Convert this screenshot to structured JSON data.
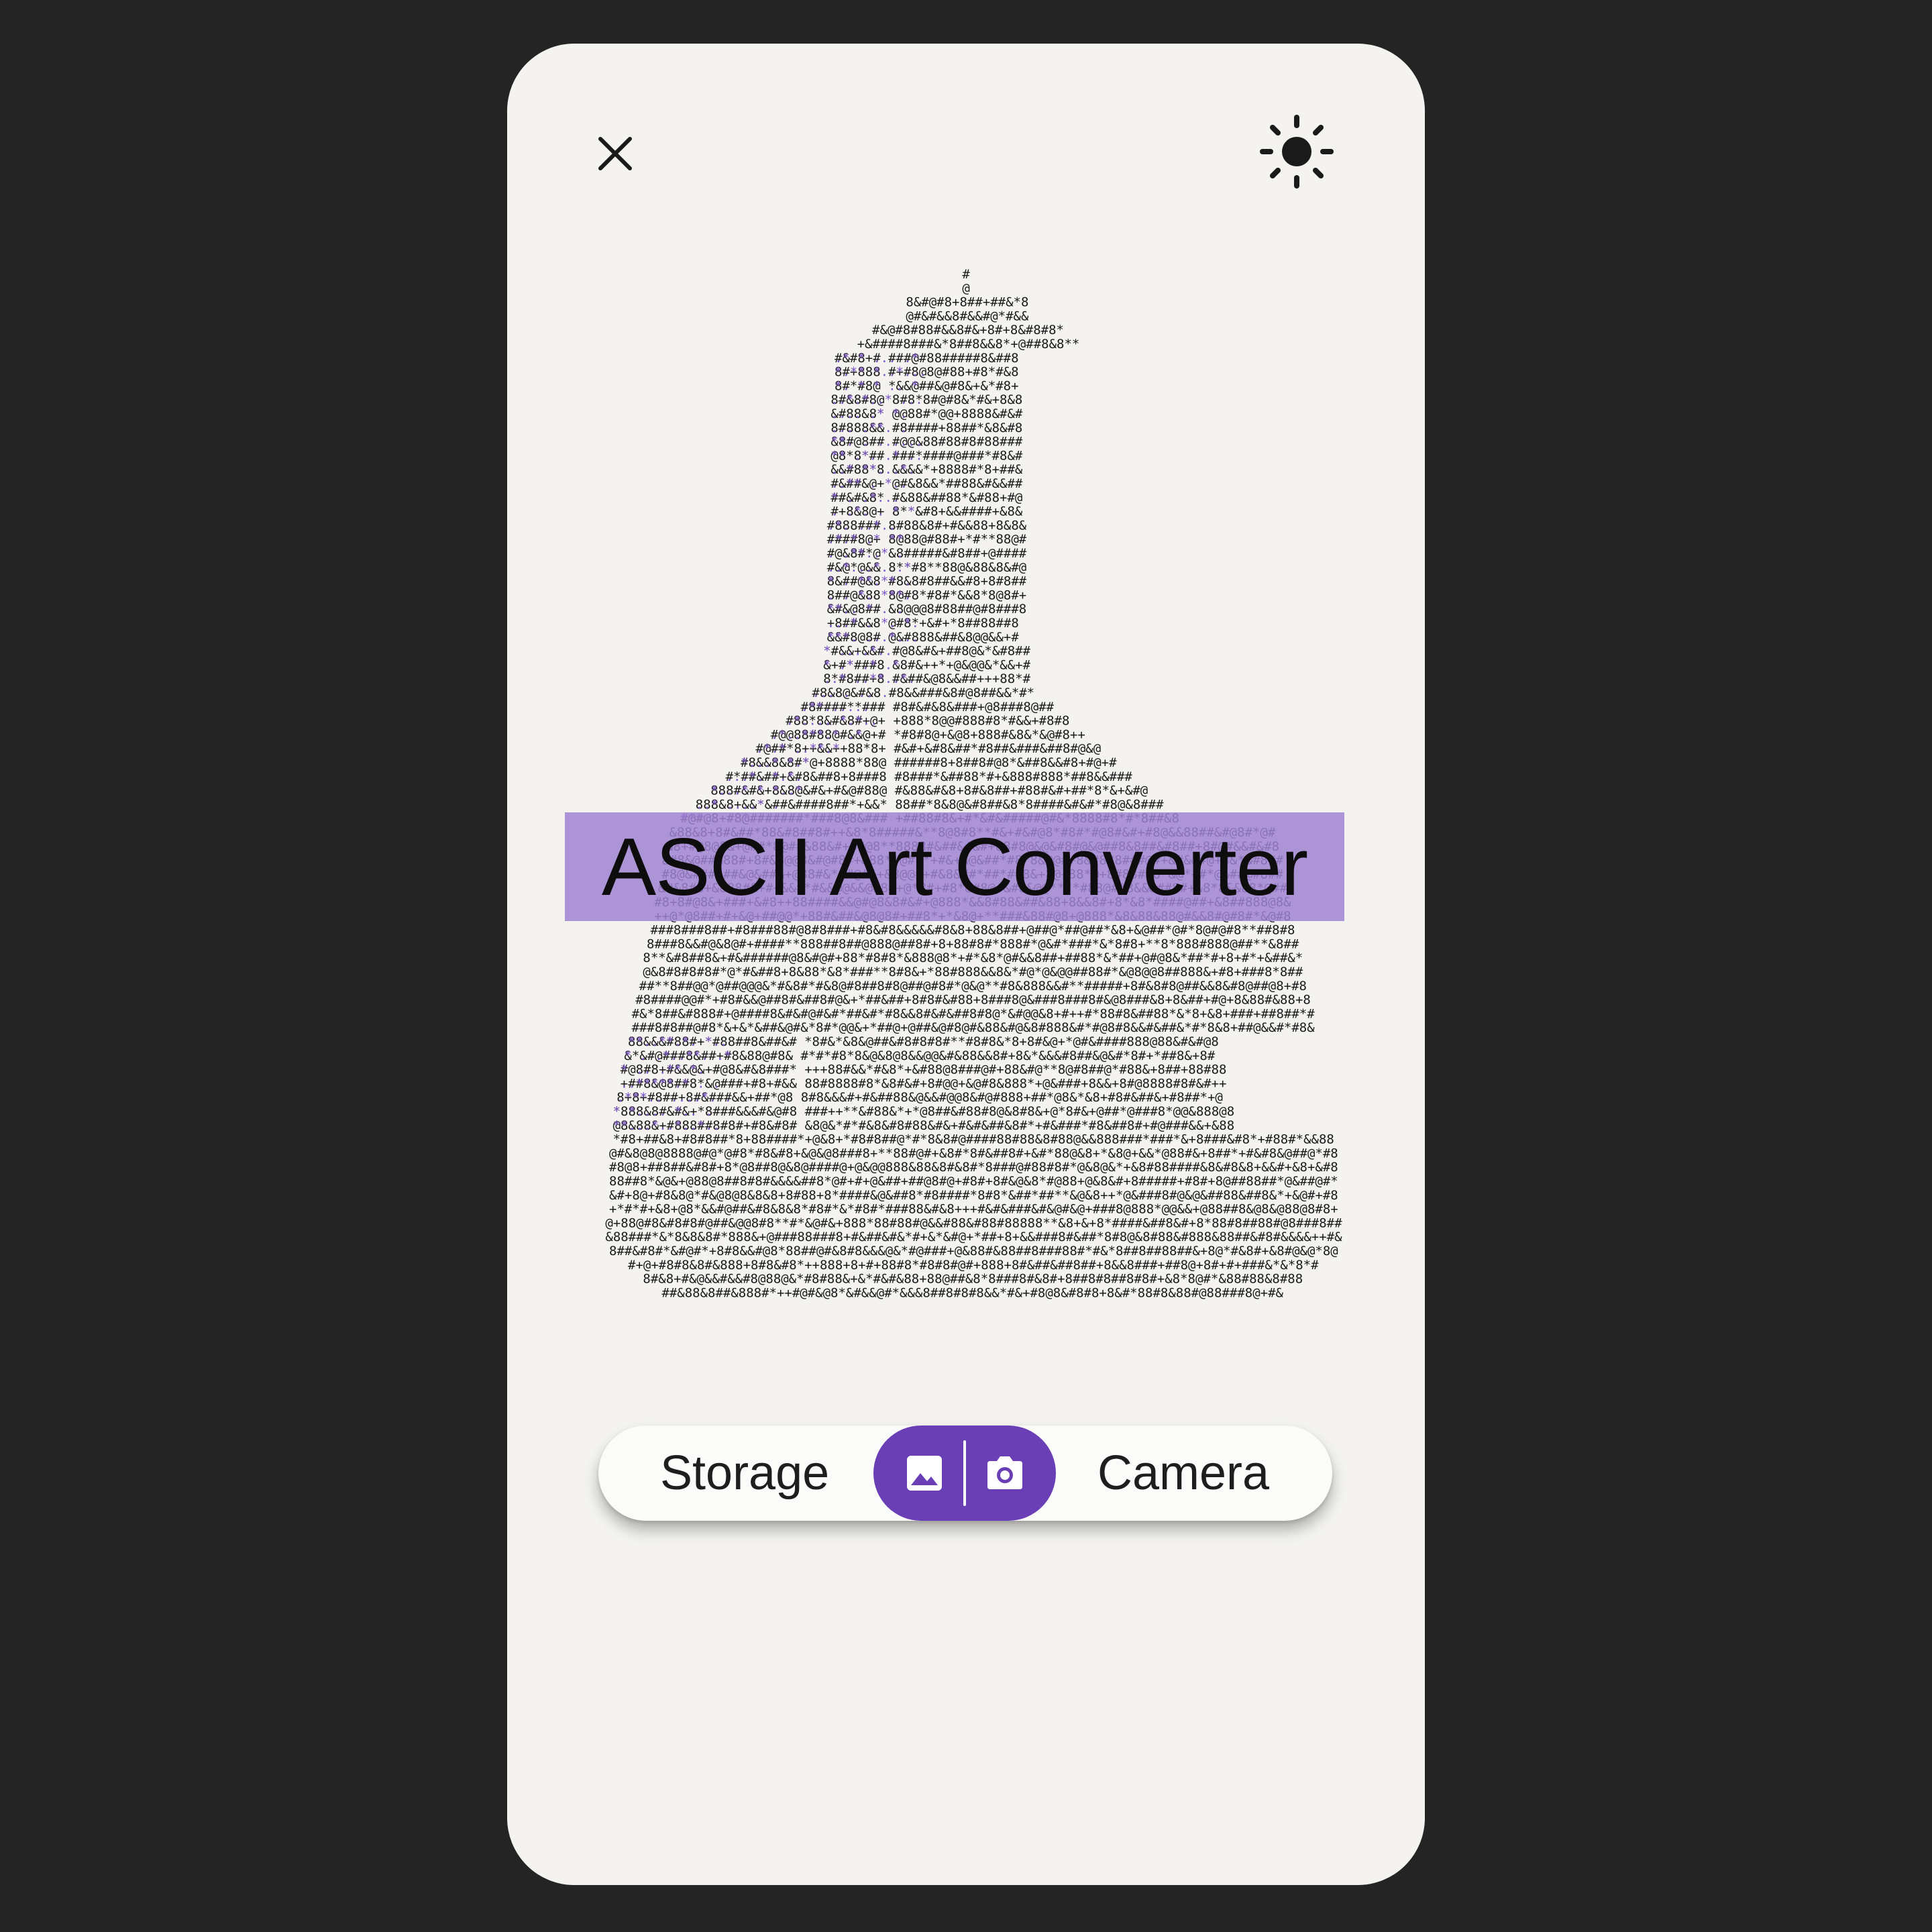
{
  "app": {
    "title": "ASCII Art Converter"
  },
  "toolbar": {
    "close_icon": "close-icon",
    "theme_icon": "sun-icon"
  },
  "source_selector": {
    "storage_label": "Storage",
    "camera_label": "Camera",
    "storage_icon": "image-icon",
    "camera_icon": "camera-icon"
  },
  "colors": {
    "accent": "#6a3fb5",
    "title_band": "#a082d2",
    "background": "#242424",
    "card": "#f4f3f0",
    "ascii_ink": "#1a1a1a",
    "ascii_highlight": "#7b55c9"
  }
}
